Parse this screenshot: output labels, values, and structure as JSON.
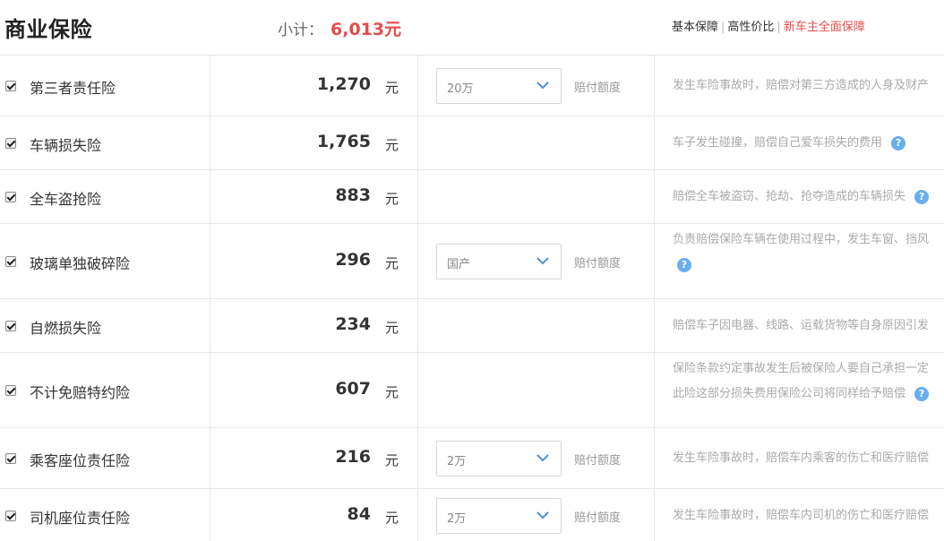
{
  "header": {
    "title": "商业保险",
    "subtotal_label": "小计：",
    "subtotal_value": "6,013元",
    "tabs": [
      "基本保障",
      "高性价比",
      "新车主全面保障"
    ],
    "active_tab": "新车主全面保障"
  },
  "colors": {
    "accent_red": "#e64c4c",
    "help_blue": "#6aaef0"
  },
  "rows": [
    {
      "name": "第三者责任险",
      "price": "1,270",
      "unit": "元",
      "select": "20万",
      "claim": "赔付额度",
      "desc": [
        "发生车险事故时，赔偿对第三方造成的人身及财产"
      ],
      "help": false
    },
    {
      "name": "车辆损失险",
      "price": "1,765",
      "unit": "元",
      "select": null,
      "claim": null,
      "desc": [
        "车子发生碰撞，赔偿自己爱车损失的费用"
      ],
      "help": true
    },
    {
      "name": "全车盗抢险",
      "price": "883",
      "unit": "元",
      "select": null,
      "claim": null,
      "desc": [
        "赔偿全车被盗窃、抢劫、抢夺造成的车辆损失"
      ],
      "help": true
    },
    {
      "name": "玻璃单独破碎险",
      "price": "296",
      "unit": "元",
      "select": "国产",
      "claim": "赔付额度",
      "desc": [
        "负责赔偿保险车辆在使用过程中，发生车窗、挡风",
        ""
      ],
      "help": true
    },
    {
      "name": "自燃损失险",
      "price": "234",
      "unit": "元",
      "select": null,
      "claim": null,
      "desc": [
        "赔偿车子因电器、线路、运载货物等自身原因引发"
      ],
      "help": false
    },
    {
      "name": "不计免赔特约险",
      "price": "607",
      "unit": "元",
      "select": null,
      "claim": null,
      "desc": [
        "保险条款约定事故发生后被保险人要自己承担一定",
        "此险这部分损失费用保险公司将同样给予赔偿"
      ],
      "help": true
    },
    {
      "name": "乘客座位责任险",
      "price": "216",
      "unit": "元",
      "select": "2万",
      "claim": "赔付额度",
      "desc": [
        "发生车险事故时，赔偿车内乘客的伤亡和医疗赔偿"
      ],
      "help": false
    },
    {
      "name": "司机座位责任险",
      "price": "84",
      "unit": "元",
      "select": "2万",
      "claim": "赔付额度",
      "desc": [
        "发生车险事故时，赔偿车内司机的伤亡和医疗赔偿"
      ],
      "help": false
    }
  ]
}
